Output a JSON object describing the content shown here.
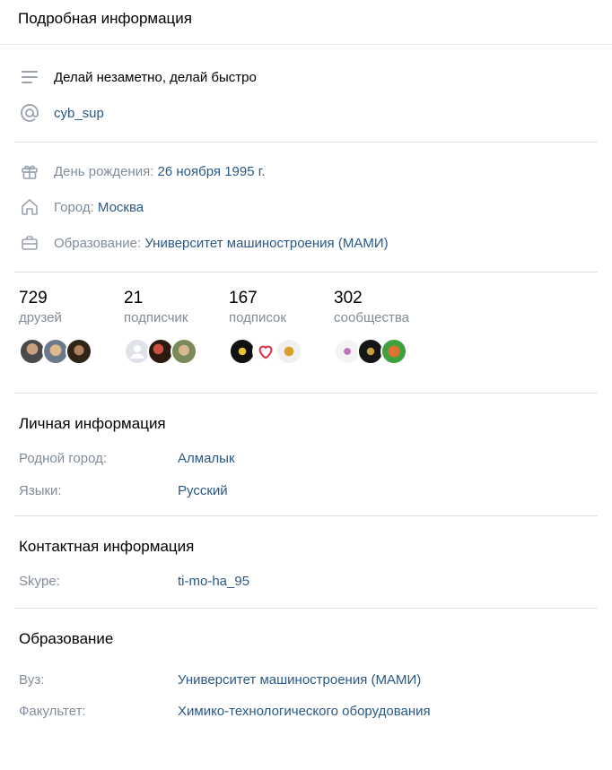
{
  "header": {
    "title": "Подробная информация"
  },
  "about": {
    "status": "Делай незаметно, делай быстро",
    "nickname": "cyb_sup"
  },
  "details": {
    "birthday_label": "День рождения:",
    "birthday_value": "26 ноября 1995 г.",
    "city_label": "Город:",
    "city_value": "Москва",
    "education_label": "Образование:",
    "education_value": "Университет машиностроения (МАМИ)"
  },
  "counters": [
    {
      "number": "729",
      "label": "друзей"
    },
    {
      "number": "21",
      "label": "подписчик"
    },
    {
      "number": "167",
      "label": "подписок"
    },
    {
      "number": "302",
      "label": "сообщества"
    }
  ],
  "personal": {
    "title": "Личная информация",
    "hometown_label": "Родной город:",
    "hometown_value": "Алмалык",
    "languages_label": "Языки:",
    "languages_value": "Русский"
  },
  "contact": {
    "title": "Контактная информация",
    "skype_label": "Skype:",
    "skype_value": "ti-mo-ha_95"
  },
  "education": {
    "title": "Образование",
    "university_label": "Вуз:",
    "university_value": "Университет машиностроения (МАМИ)",
    "faculty_label": "Факультет:",
    "faculty_value": "Химико-технологического оборудования"
  },
  "colors": {
    "link": "#2a5885",
    "muted": "#818c99",
    "divider": "#dce1e6",
    "icon": "#99a2ad"
  }
}
